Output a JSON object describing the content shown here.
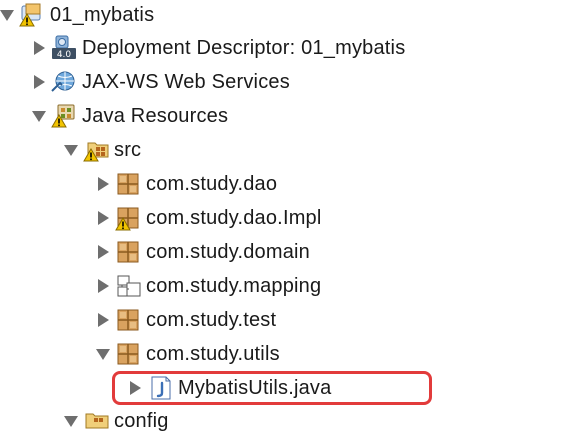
{
  "tree": {
    "project": {
      "label": "01_mybatis",
      "icon": "project-warning-icon"
    },
    "items": [
      {
        "label": "Deployment Descriptor: 01_mybatis",
        "icon": "deployment-descriptor-icon"
      },
      {
        "label": "JAX-WS Web Services",
        "icon": "web-services-icon"
      },
      {
        "label": "Java Resources",
        "icon": "java-resources-warning-icon"
      },
      {
        "label": "src",
        "icon": "source-folder-warning-icon"
      },
      {
        "label": "com.study.dao",
        "icon": "package-icon"
      },
      {
        "label": "com.study.dao.Impl",
        "icon": "package-warning-icon"
      },
      {
        "label": "com.study.domain",
        "icon": "package-icon"
      },
      {
        "label": "com.study.mapping",
        "icon": "empty-package-icon"
      },
      {
        "label": "com.study.test",
        "icon": "package-icon"
      },
      {
        "label": "com.study.utils",
        "icon": "package-icon"
      },
      {
        "label": "MybatisUtils.java",
        "icon": "java-file-icon"
      },
      {
        "label": "config",
        "icon": "source-folder-icon"
      }
    ]
  },
  "highlight": {
    "color": "#e23b3b"
  }
}
